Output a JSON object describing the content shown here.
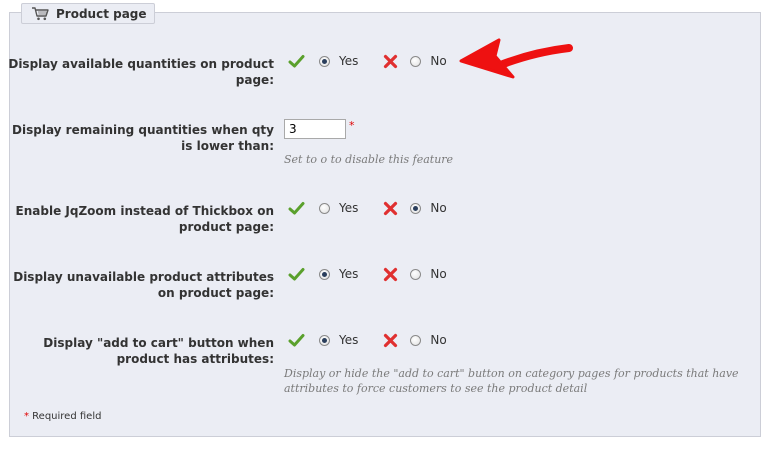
{
  "section": {
    "title": "Product page",
    "icon": "shopping-cart-icon"
  },
  "rows": [
    {
      "label_line1": "Display available quantities on product",
      "label_line2": "page:",
      "yes": "Yes",
      "no": "No",
      "selected": "yes"
    },
    {
      "label_line1": "Display remaining quantities when qty",
      "label_line2": "is lower than:",
      "input_value": "3",
      "required_marker": "*",
      "hint": "Set to o to disable this feature"
    },
    {
      "label_line1": "Enable JqZoom instead of Thickbox on",
      "label_line2": "product page:",
      "yes": "Yes",
      "no": "No",
      "selected": "no"
    },
    {
      "label_line1": "Display unavailable product attributes",
      "label_line2": "on product page:",
      "yes": "Yes",
      "no": "No",
      "selected": "yes"
    },
    {
      "label_line1": "Display \"add to cart\" button when",
      "label_line2": "product has attributes:",
      "yes": "Yes",
      "no": "No",
      "selected": "yes",
      "hint_line1": "Display or hide the \"add to cart\" button on category pages for products that have",
      "hint_line2": "attributes to force customers to see the product detail"
    }
  ],
  "footer": {
    "required_star": "*",
    "required_text": " Required field"
  },
  "colors": {
    "panel_bg": "#ebedf4",
    "panel_border": "#ccced7",
    "check_green": "#5aa02c",
    "cross_red": "#e03030",
    "annotation_arrow": "#ee1111"
  }
}
